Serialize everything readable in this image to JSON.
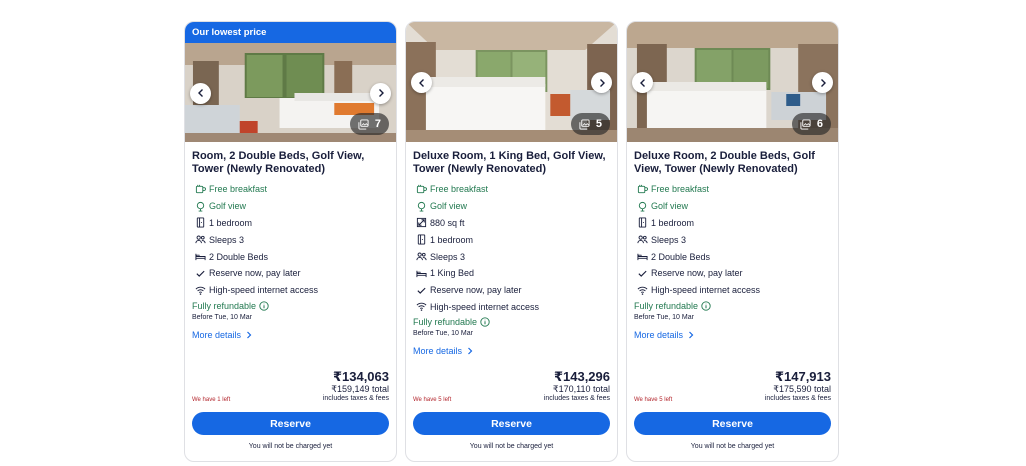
{
  "cards": [
    {
      "badge": "Our lowest price",
      "photo_count": "7",
      "title": "Room, 2 Double Beds, Golf View, Tower (Newly Renovated)",
      "features": [
        {
          "icon": "breakfast-icon",
          "text": "Free breakfast",
          "green": true
        },
        {
          "icon": "view-icon",
          "text": "Golf view",
          "green": true
        },
        {
          "icon": "bedroom-icon",
          "text": "1 bedroom",
          "green": false
        },
        {
          "icon": "people-icon",
          "text": "Sleeps 3",
          "green": false
        },
        {
          "icon": "bed-icon",
          "text": "2 Double Beds",
          "green": false
        },
        {
          "icon": "check-icon",
          "text": "Reserve now, pay later",
          "green": false
        },
        {
          "icon": "wifi-icon",
          "text": "High-speed internet access",
          "green": false
        }
      ],
      "refund": "Fully refundable",
      "before": "Before Tue, 10 Mar",
      "more": "More details",
      "price": "₹134,063",
      "total": "₹159,149 total",
      "includes": "includes taxes & fees",
      "left": "We have 1 left",
      "reserve": "Reserve",
      "charged": "You will not be charged yet"
    },
    {
      "photo_count": "5",
      "title": "Deluxe Room, 1 King Bed, Golf View, Tower (Newly Renovated)",
      "features": [
        {
          "icon": "breakfast-icon",
          "text": "Free breakfast",
          "green": true
        },
        {
          "icon": "view-icon",
          "text": "Golf view",
          "green": true
        },
        {
          "icon": "area-icon",
          "text": "880 sq ft",
          "green": false
        },
        {
          "icon": "bedroom-icon",
          "text": "1 bedroom",
          "green": false
        },
        {
          "icon": "people-icon",
          "text": "Sleeps 3",
          "green": false
        },
        {
          "icon": "bed-icon",
          "text": "1 King Bed",
          "green": false
        },
        {
          "icon": "check-icon",
          "text": "Reserve now, pay later",
          "green": false
        },
        {
          "icon": "wifi-icon",
          "text": "High-speed internet access",
          "green": false
        }
      ],
      "refund": "Fully refundable",
      "before": "Before Tue, 10 Mar",
      "more": "More details",
      "price": "₹143,296",
      "total": "₹170,110 total",
      "includes": "includes taxes & fees",
      "left": "We have 5 left",
      "reserve": "Reserve",
      "charged": "You will not be charged yet"
    },
    {
      "photo_count": "6",
      "title": "Deluxe Room, 2 Double Beds, Golf View, Tower (Newly Renovated)",
      "features": [
        {
          "icon": "breakfast-icon",
          "text": "Free breakfast",
          "green": true
        },
        {
          "icon": "view-icon",
          "text": "Golf view",
          "green": true
        },
        {
          "icon": "bedroom-icon",
          "text": "1 bedroom",
          "green": false
        },
        {
          "icon": "people-icon",
          "text": "Sleeps 3",
          "green": false
        },
        {
          "icon": "bed-icon",
          "text": "2 Double Beds",
          "green": false
        },
        {
          "icon": "check-icon",
          "text": "Reserve now, pay later",
          "green": false
        },
        {
          "icon": "wifi-icon",
          "text": "High-speed internet access",
          "green": false
        }
      ],
      "refund": "Fully refundable",
      "before": "Before Tue, 10 Mar",
      "more": "More details",
      "price": "₹147,913",
      "total": "₹175,590 total",
      "includes": "includes taxes & fees",
      "left": "We have 5 left",
      "reserve": "Reserve",
      "charged": "You will not be charged yet"
    }
  ],
  "colors": {
    "brand": "#1668e3",
    "green": "#227950",
    "urgent": "#b3262d",
    "text": "#191e3b"
  }
}
